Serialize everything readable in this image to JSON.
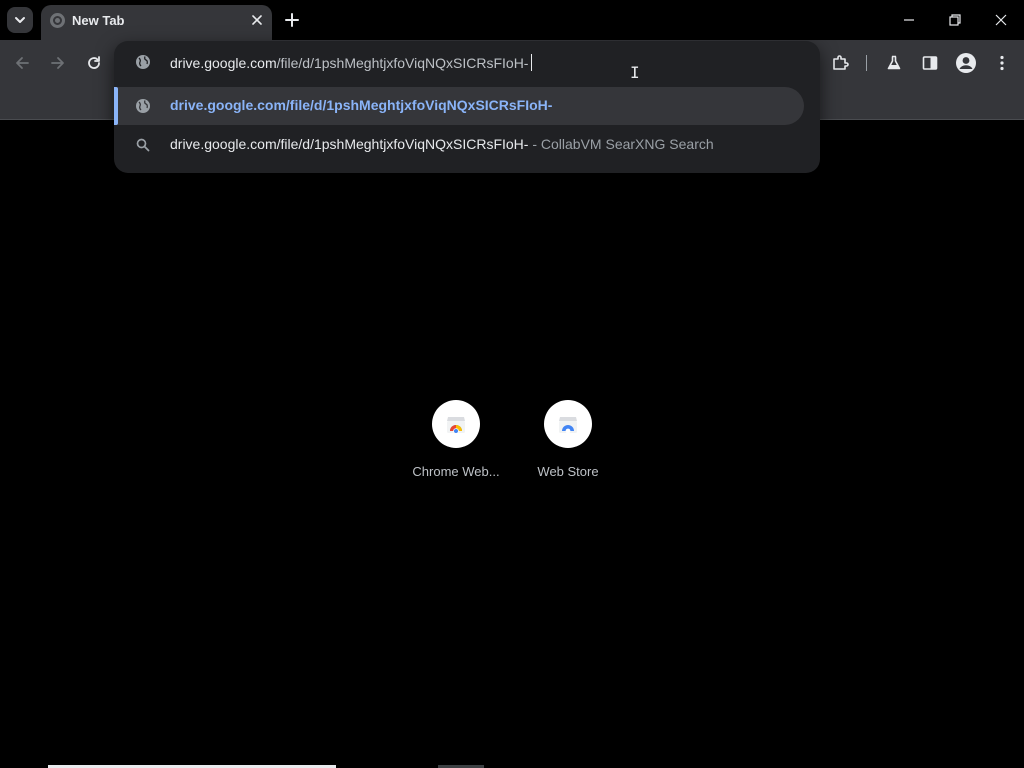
{
  "tab": {
    "title": "New Tab"
  },
  "omnibox": {
    "value_host": "drive.google.com",
    "value_path": "/file/d/1pshMeghtjxfoViqNQxSICRsFIoH-",
    "suggestions": [
      {
        "icon": "globe-icon",
        "text": "drive.google.com/file/d/1pshMeghtjxfoViqNQxSICRsFIoH-"
      },
      {
        "icon": "search-icon",
        "text": "drive.google.com/file/d/1pshMeghtjxfoViqNQxSICRsFIoH-",
        "separator": "-",
        "engine": "CollabVM SearXNG Search"
      }
    ]
  },
  "shortcuts": [
    {
      "label": "Chrome Web...",
      "icon": "chrome-web-store-icon"
    },
    {
      "label": "Web Store",
      "icon": "web-store-icon"
    }
  ],
  "colors": {
    "accent": "#8ab4f8",
    "toolbar": "#35363a",
    "popup": "#202124"
  }
}
